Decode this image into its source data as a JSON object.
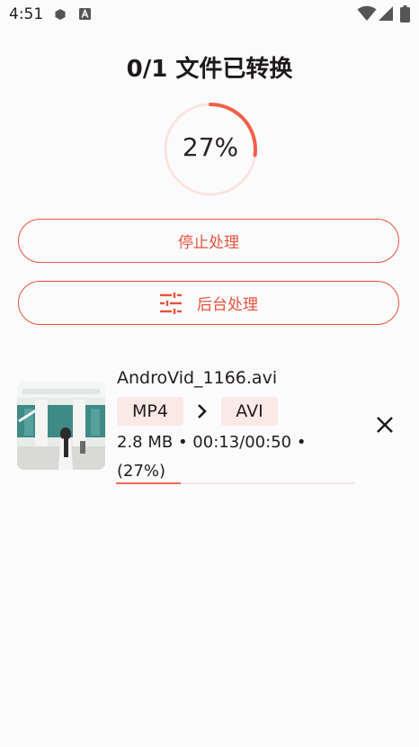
{
  "status_bar": {
    "time": "4:51"
  },
  "title": "0/1 文件已转换",
  "progress": {
    "text": "27%",
    "value": 0.27
  },
  "buttons": {
    "stop_label": "停止处理",
    "background_label": "后台处理"
  },
  "file": {
    "name": "AndroVid_1166.avi",
    "source_format": "MP4",
    "target_format": "AVI",
    "meta": "2.8 MB • 00:13/00:50 • (27%)",
    "progress_value": 0.27
  },
  "colors": {
    "accent": "#e5533f",
    "chip_bg": "#fbe9e6",
    "ring_track": "#fbe4df",
    "background": "#fcfbfb"
  }
}
